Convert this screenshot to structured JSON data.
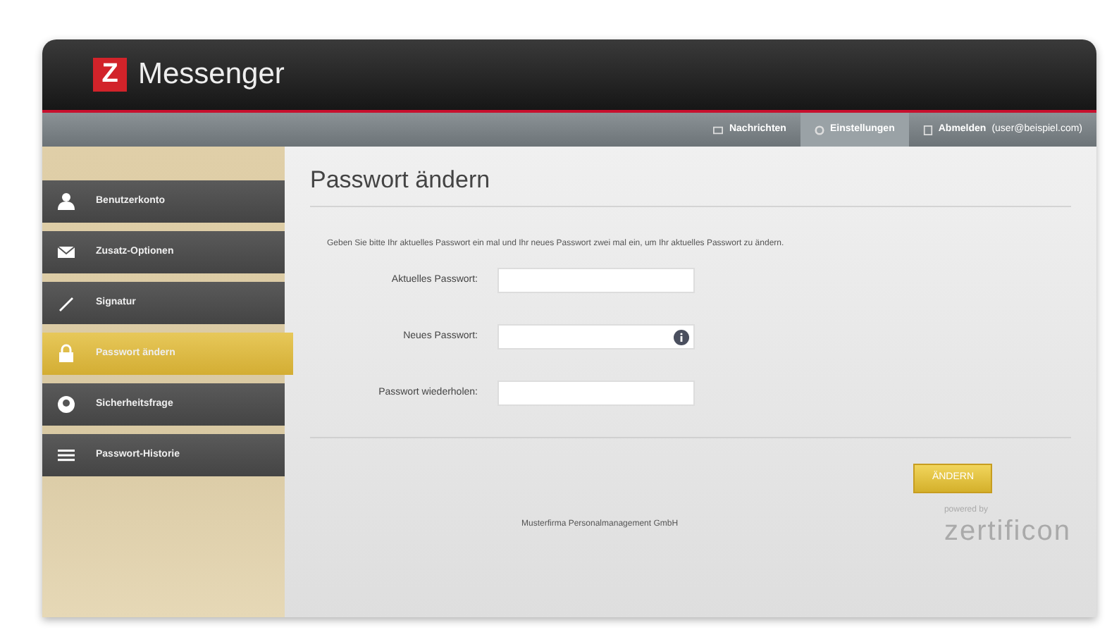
{
  "header": {
    "logo_letter": "Z",
    "title": "Messenger"
  },
  "nav": [
    {
      "label": "Nachrichten",
      "selected": false,
      "kind": "messages"
    },
    {
      "label": "Einstellungen",
      "selected": true,
      "kind": "settings"
    },
    {
      "label": "Abmelden",
      "detail": "(user@beispiel.com)",
      "selected": false,
      "kind": "logout"
    }
  ],
  "sidebar": {
    "items": [
      {
        "label": "Benutzerkonto",
        "kind": "user",
        "selected": false
      },
      {
        "label": "Zusatz-Optionen",
        "kind": "mail",
        "selected": false
      },
      {
        "label": "Signatur",
        "kind": "pen",
        "selected": false
      },
      {
        "label": "Passwort ändern",
        "kind": "lock",
        "selected": true
      },
      {
        "label": "Sicherheitsfrage",
        "kind": "question",
        "selected": false
      },
      {
        "label": "Passwort-Historie",
        "kind": "list",
        "selected": false
      }
    ]
  },
  "page": {
    "title": "Passwort ändern",
    "intro": "Geben Sie bitte Ihr aktuelles Passwort ein mal und Ihr neues Passwort zwei mal ein, um Ihr aktuelles Passwort zu ändern.",
    "fields": [
      {
        "label": "Aktuelles Passwort:",
        "info": false
      },
      {
        "label": "Neues Passwort:",
        "info": true
      },
      {
        "label": "Passwort wiederholen:",
        "info": false
      }
    ],
    "button": "ÄNDERN",
    "footer": "Musterfirma Personalmanagement GmbH",
    "powered_by": "powered by",
    "brand": "zertificon"
  }
}
